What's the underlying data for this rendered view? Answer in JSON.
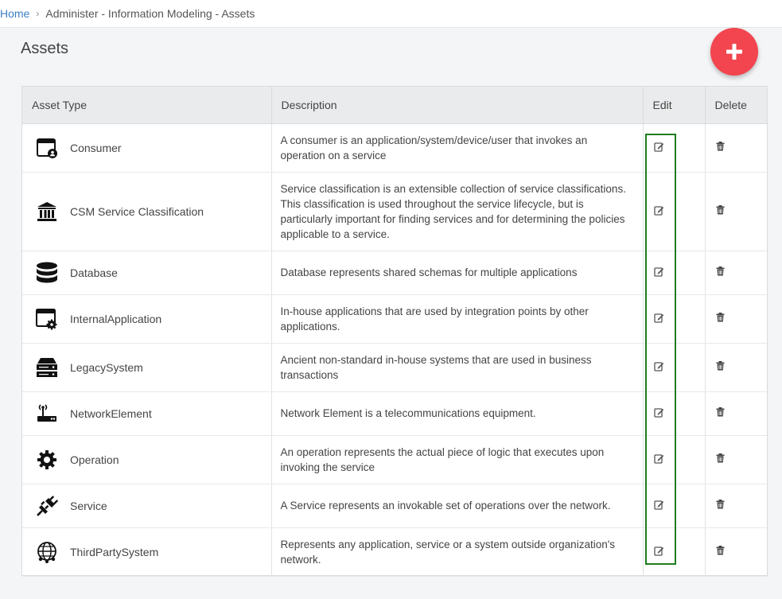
{
  "breadcrumb": {
    "home": "Home",
    "current": "Administer - Information Modeling - Assets"
  },
  "page": {
    "title": "Assets",
    "add_icon": "plus-icon",
    "accent_color": "#f2454f"
  },
  "table": {
    "headers": {
      "asset_type": "Asset Type",
      "description": "Description",
      "edit": "Edit",
      "delete": "Delete"
    },
    "rows": [
      {
        "name": "Consumer",
        "icon": "consumer-icon",
        "description": "A consumer is an application/system/device/user that invokes an operation on a service"
      },
      {
        "name": "CSM Service Classification",
        "icon": "institution-icon",
        "description": "Service classification is an extensible collection of service classifications.  This classification is used throughout the service lifecycle, but is particularly important for finding services and for determining the policies applicable to a service."
      },
      {
        "name": "Database",
        "icon": "database-icon",
        "description": "Database represents shared schemas for multiple applications"
      },
      {
        "name": "InternalApplication",
        "icon": "app-settings-icon",
        "description": "In-house applications that are used by integration points by other applications."
      },
      {
        "name": "LegacySystem",
        "icon": "server-icon",
        "description": "Ancient non-standard in-house systems that are used in business transactions"
      },
      {
        "name": "NetworkElement",
        "icon": "router-icon",
        "description": "Network Element is a telecommunications equipment."
      },
      {
        "name": "Operation",
        "icon": "gear-icon",
        "description": "An operation represents the actual piece of logic that executes upon invoking the service"
      },
      {
        "name": "Service",
        "icon": "plug-icon",
        "description": "A Service represents an invokable set of operations over the network."
      },
      {
        "name": "ThirdPartySystem",
        "icon": "globe-network-icon",
        "description": "Represents any application, service or a system outside organization's network."
      }
    ],
    "edit_icon": "edit-icon",
    "delete_icon": "trash-icon"
  }
}
